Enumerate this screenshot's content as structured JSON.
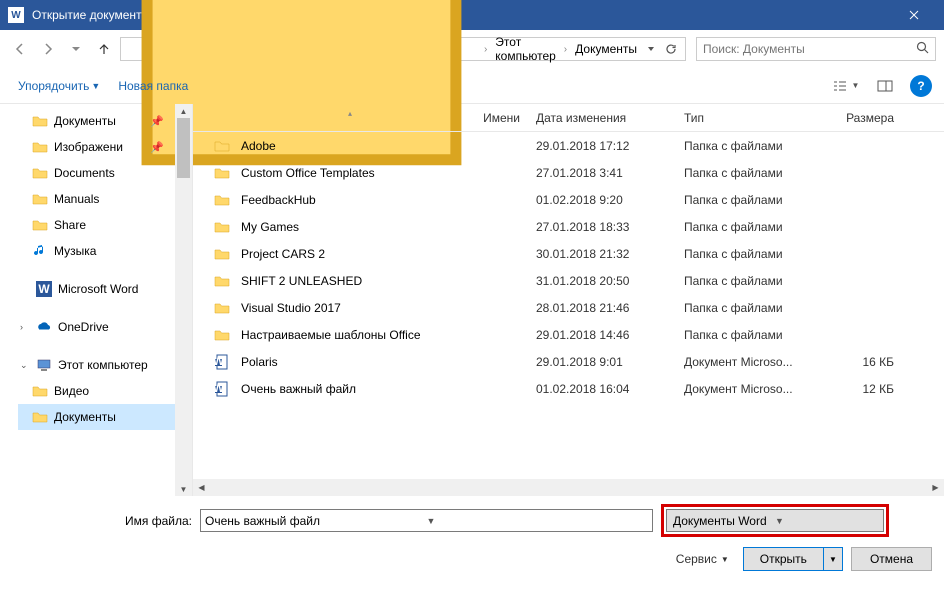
{
  "window": {
    "title": "Открытие документа"
  },
  "breadcrumb": {
    "root": "Этот компьютер",
    "current": "Документы"
  },
  "search": {
    "placeholder": "Поиск: Документы"
  },
  "toolbar": {
    "organize": "Упорядочить",
    "new_folder": "Новая папка"
  },
  "columns": {
    "name": "Имени",
    "date": "Дата изменения",
    "type": "Тип",
    "size": "Размера"
  },
  "sidebar": {
    "quick": [
      {
        "label": "Документы",
        "icon": "folder",
        "pinned": true
      },
      {
        "label": "Изображени",
        "icon": "folder",
        "pinned": true
      },
      {
        "label": "Documents",
        "icon": "folder"
      },
      {
        "label": "Manuals",
        "icon": "folder"
      },
      {
        "label": "Share",
        "icon": "folder"
      },
      {
        "label": "Музыка",
        "icon": "music"
      }
    ],
    "word": "Microsoft Word",
    "onedrive": "OneDrive",
    "thispc": "Этот компьютер",
    "pc_children": [
      {
        "label": "Видео",
        "icon": "folder"
      },
      {
        "label": "Документы",
        "icon": "folder",
        "selected": true
      }
    ]
  },
  "files": [
    {
      "name": "Adobe",
      "date": "29.01.2018 17:12",
      "type": "Папка с файлами",
      "size": "",
      "icon": "folder"
    },
    {
      "name": "Custom Office Templates",
      "date": "27.01.2018 3:41",
      "type": "Папка с файлами",
      "size": "",
      "icon": "folder"
    },
    {
      "name": "FeedbackHub",
      "date": "01.02.2018 9:20",
      "type": "Папка с файлами",
      "size": "",
      "icon": "folder"
    },
    {
      "name": "My Games",
      "date": "27.01.2018 18:33",
      "type": "Папка с файлами",
      "size": "",
      "icon": "folder"
    },
    {
      "name": "Project CARS 2",
      "date": "30.01.2018 21:32",
      "type": "Папка с файлами",
      "size": "",
      "icon": "folder"
    },
    {
      "name": "SHIFT 2 UNLEASHED",
      "date": "31.01.2018 20:50",
      "type": "Папка с файлами",
      "size": "",
      "icon": "folder"
    },
    {
      "name": "Visual Studio 2017",
      "date": "28.01.2018 21:46",
      "type": "Папка с файлами",
      "size": "",
      "icon": "folder"
    },
    {
      "name": "Настраиваемые шаблоны Office",
      "date": "29.01.2018 14:46",
      "type": "Папка с файлами",
      "size": "",
      "icon": "folder"
    },
    {
      "name": "Polaris",
      "date": "29.01.2018 9:01",
      "type": "Документ Microso...",
      "size": "16 КБ",
      "icon": "doc"
    },
    {
      "name": "Очень важный файл",
      "date": "01.02.2018 16:04",
      "type": "Документ Microso...",
      "size": "12 КБ",
      "icon": "doc"
    }
  ],
  "footer": {
    "filename_label": "Имя файла:",
    "filename_value": "Очень важный файл",
    "filter_value": "Документы Word",
    "tools": "Сервис",
    "open": "Открыть",
    "cancel": "Отмена"
  }
}
